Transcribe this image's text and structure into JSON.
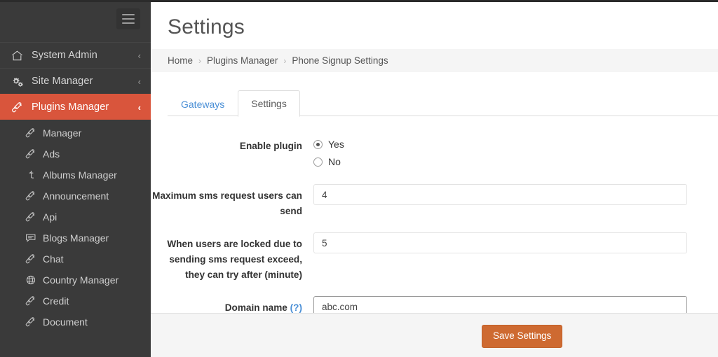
{
  "theme": {
    "sidebar_bg": "#3a3a3a",
    "sidebar_active_bg": "#d9553c",
    "accent_link": "#4a8fd6",
    "button_bg": "#ce6a31",
    "panel_bg": "#f5f5f5"
  },
  "sidebar": {
    "toggle_icon": "hamburger-icon",
    "items": [
      {
        "label": "System Admin",
        "icon": "home-icon",
        "caret": "‹",
        "active": false
      },
      {
        "label": "Site Manager",
        "icon": "gears-icon",
        "caret": "‹",
        "active": false
      },
      {
        "label": "Plugins Manager",
        "icon": "plug-icon",
        "caret": "‹",
        "active": true
      }
    ],
    "subitems": [
      {
        "label": "Manager",
        "icon": "plug-icon"
      },
      {
        "label": "Ads",
        "icon": "plug-icon"
      },
      {
        "label": "Albums Manager",
        "icon": "tumblr-icon"
      },
      {
        "label": "Announcement",
        "icon": "plug-icon"
      },
      {
        "label": "Api",
        "icon": "plug-icon"
      },
      {
        "label": "Blogs Manager",
        "icon": "comment-icon"
      },
      {
        "label": "Chat",
        "icon": "plug-icon"
      },
      {
        "label": "Country Manager",
        "icon": "globe-icon"
      },
      {
        "label": "Credit",
        "icon": "plug-icon"
      },
      {
        "label": "Document",
        "icon": "plug-icon"
      }
    ]
  },
  "header": {
    "title": "Settings"
  },
  "breadcrumb": {
    "separator": "›",
    "items": [
      "Home",
      "Plugins Manager",
      "Phone Signup Settings"
    ]
  },
  "tabs": [
    {
      "label": "Gateways",
      "active": false
    },
    {
      "label": "Settings",
      "active": true
    }
  ],
  "form": {
    "enable_plugin": {
      "label": "Enable plugin",
      "options": [
        {
          "label": "Yes",
          "checked": true
        },
        {
          "label": "No",
          "checked": false
        }
      ]
    },
    "max_sms": {
      "label": "Maximum sms request users can send",
      "value": "4",
      "placeholder": ""
    },
    "lock_minutes": {
      "label": "When users are locked due to sending sms request exceed, they can try after (minute)",
      "value": "5",
      "placeholder": ""
    },
    "domain_name": {
      "label": "Domain name",
      "help_marker": "(?)",
      "value": "abc.com",
      "placeholder": ""
    }
  },
  "footer": {
    "save_label": "Save Settings"
  }
}
